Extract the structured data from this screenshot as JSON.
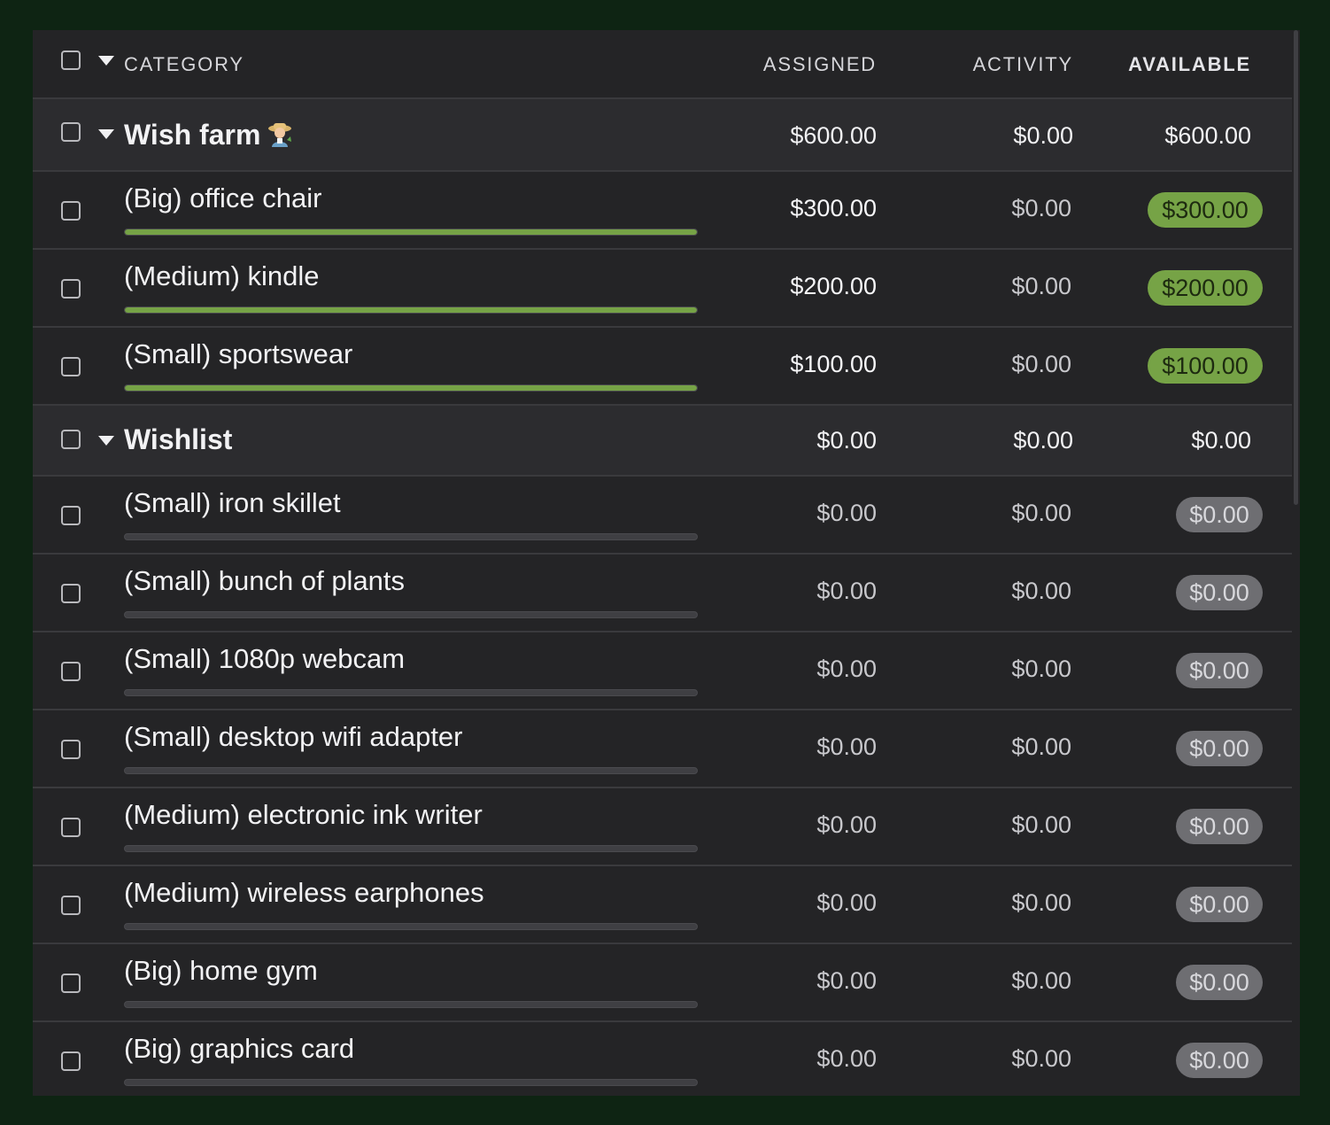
{
  "header": {
    "category": "CATEGORY",
    "assigned": "ASSIGNED",
    "activity": "ACTIVITY",
    "available": "AVAILABLE"
  },
  "groups": [
    {
      "name": "Wish farm",
      "icon": "farmer-emoji-icon",
      "assigned": "$600.00",
      "activity": "$0.00",
      "available": "$600.00",
      "items": [
        {
          "name": "(Big) office chair",
          "assigned": "$300.00",
          "activity": "$0.00",
          "available": "$300.00",
          "funded_fraction": 1,
          "status": "funded"
        },
        {
          "name": "(Medium) kindle",
          "assigned": "$200.00",
          "activity": "$0.00",
          "available": "$200.00",
          "funded_fraction": 1,
          "status": "funded"
        },
        {
          "name": "(Small) sportswear",
          "assigned": "$100.00",
          "activity": "$0.00",
          "available": "$100.00",
          "funded_fraction": 1,
          "status": "funded"
        }
      ]
    },
    {
      "name": "Wishlist",
      "assigned": "$0.00",
      "activity": "$0.00",
      "available": "$0.00",
      "items": [
        {
          "name": "(Small) iron skillet",
          "assigned": "$0.00",
          "activity": "$0.00",
          "available": "$0.00",
          "funded_fraction": 0,
          "status": "empty"
        },
        {
          "name": "(Small) bunch of plants",
          "assigned": "$0.00",
          "activity": "$0.00",
          "available": "$0.00",
          "funded_fraction": 0,
          "status": "empty"
        },
        {
          "name": "(Small) 1080p webcam",
          "assigned": "$0.00",
          "activity": "$0.00",
          "available": "$0.00",
          "funded_fraction": 0,
          "status": "empty"
        },
        {
          "name": "(Small) desktop wifi adapter",
          "assigned": "$0.00",
          "activity": "$0.00",
          "available": "$0.00",
          "funded_fraction": 0,
          "status": "empty"
        },
        {
          "name": "(Medium) electronic ink writer",
          "assigned": "$0.00",
          "activity": "$0.00",
          "available": "$0.00",
          "funded_fraction": 0,
          "status": "empty"
        },
        {
          "name": "(Medium) wireless earphones",
          "assigned": "$0.00",
          "activity": "$0.00",
          "available": "$0.00",
          "funded_fraction": 0,
          "status": "empty"
        },
        {
          "name": "(Big) home gym",
          "assigned": "$0.00",
          "activity": "$0.00",
          "available": "$0.00",
          "funded_fraction": 0,
          "status": "empty"
        },
        {
          "name": "(Big) graphics card",
          "assigned": "$0.00",
          "activity": "$0.00",
          "available": "$0.00",
          "funded_fraction": 0,
          "status": "empty"
        }
      ]
    }
  ],
  "colors": {
    "background": "#0e2413",
    "panel": "#242426",
    "group_row": "#2c2c2f",
    "funded_green": "#76a346",
    "empty_gray": "#6e6e72"
  }
}
